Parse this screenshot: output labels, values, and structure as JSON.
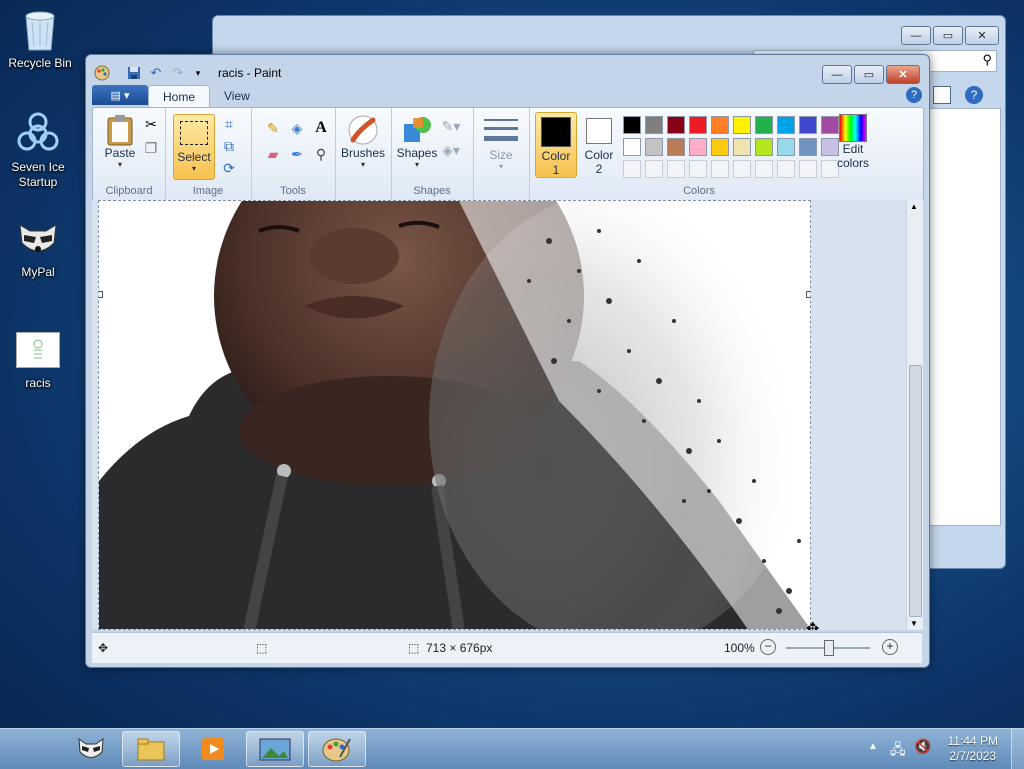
{
  "desktop": {
    "icons": [
      {
        "label": "Recycle Bin",
        "icon": "recycle-bin-icon"
      },
      {
        "label": "Seven Ice Startup",
        "icon": "biohazard-icon"
      },
      {
        "label": "MyPal",
        "icon": "raccoon-icon"
      },
      {
        "label": "racis",
        "icon": "image-file-icon"
      }
    ]
  },
  "paint": {
    "title": "racis - Paint",
    "tabs": {
      "home": "Home",
      "view": "View"
    },
    "clipboard": {
      "paste": "Paste",
      "group": "Clipboard"
    },
    "image": {
      "select": "Select",
      "group": "Image"
    },
    "tools": {
      "group": "Tools"
    },
    "brushes": {
      "label": "Brushes"
    },
    "shapes": {
      "label": "Shapes",
      "group": "Shapes"
    },
    "size": {
      "label": "Size"
    },
    "colors": {
      "color1_label": "Color",
      "color1_num": "1",
      "color2_label": "Color",
      "color2_num": "2",
      "edit_label": "Edit",
      "edit_label2": "colors",
      "group": "Colors",
      "color1": "#000000",
      "color2": "#ffffff",
      "row1": [
        "#000000",
        "#7f7f7f",
        "#880015",
        "#ed1c24",
        "#ff7f27",
        "#fff200",
        "#22b14c",
        "#00a2e8",
        "#3f48cc",
        "#a349a4"
      ],
      "row2": [
        "#ffffff",
        "#c3c3c3",
        "#b97a57",
        "#ffaec9",
        "#ffc90e",
        "#efe4b0",
        "#b5e61d",
        "#99d9ea",
        "#7092be",
        "#c8bfe7"
      ]
    },
    "status": {
      "dimensions": "713 × 676px",
      "zoom": "100%"
    }
  },
  "taskbar": {
    "time": "11:44 PM",
    "date": "2/7/2023"
  }
}
